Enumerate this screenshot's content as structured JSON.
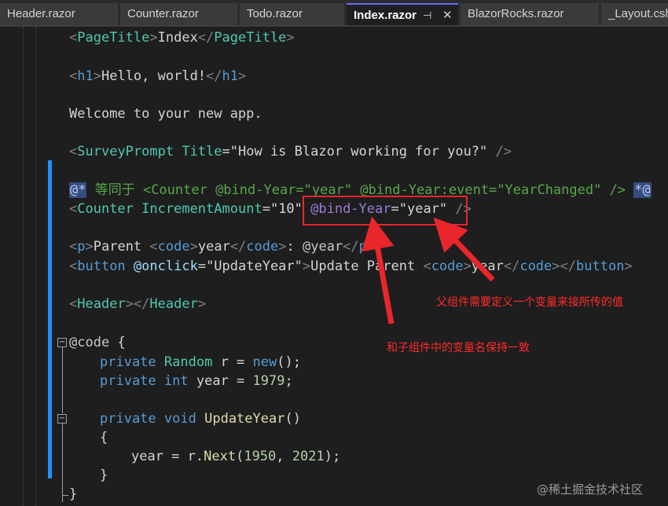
{
  "tabs": [
    {
      "label": "Header.razor"
    },
    {
      "label": "Counter.razor"
    },
    {
      "label": "Todo.razor"
    },
    {
      "label": "Index.razor",
      "pin": "⊣",
      "close": "✕"
    },
    {
      "label": "BlazorRocks.razor"
    },
    {
      "label": "_Layout.csht"
    }
  ],
  "code": {
    "l1": {
      "lt": "<",
      "tag": "PageTitle",
      "gt": ">",
      "text": "Index",
      "lt2": "</",
      "tag2": "PageTitle",
      "gt2": ">"
    },
    "l3": {
      "lt": "<",
      "tag": "h1",
      "gt": ">",
      "text": "Hello, world!",
      "lt2": "</",
      "tag2": "h1",
      "gt2": ">"
    },
    "l5": {
      "text": "Welcome to your new app."
    },
    "l7": {
      "lt": "<",
      "tag": "SurveyPrompt",
      "attr": "Title",
      "eq": "=",
      "str": "\"How is Blazor working for you?\"",
      "end": " />"
    },
    "l9": {
      "start": "@*",
      "comment": " 等同于 <Counter @bind-Year=\"year\" @bind-Year:event=\"YearChanged\" /> ",
      "end": "*@"
    },
    "l10": {
      "lt": "<",
      "tag": "Counter",
      "attr": "IncrementAmount",
      "eq": "=",
      "str": "\"10\"",
      "bind": "@bind-Year",
      "eq2": "=",
      "str2": "\"year\"",
      "end": " />"
    },
    "l12": {
      "lt": "<",
      "tag": "p",
      "gt": ">",
      "text": "Parent ",
      "lt2": "<",
      "tag2": "code",
      "gt2": ">",
      "var": "year",
      "lt3": "</",
      "tag3": "code",
      "gt3": ">",
      "colon": ": ",
      "razor": "@year",
      "lt4": "</",
      "tag4": "p",
      "gt4": ">"
    },
    "l13": {
      "lt": "<",
      "tag": "button",
      "attr": "@onclick",
      "eq": "=",
      "str": "\"UpdateYear\"",
      "gt": ">",
      "text": "Update Parent ",
      "lt2": "<",
      "tag2": "code",
      "gt2": ">",
      "var": "year",
      "lt3": "</",
      "tag3": "code",
      "gt3": ">",
      "lt4": "</",
      "tag4": "button",
      "gt4": ">"
    },
    "l15": {
      "lt": "<",
      "tag": "Header",
      "gt": ">",
      "lt2": "</",
      "tag2": "Header",
      "gt2": ">"
    },
    "l17": {
      "kw": "@code",
      "brace": " {"
    },
    "l18": {
      "kw": "private",
      "type": "Random",
      "name": " r = ",
      "kw2": "new",
      "end": "();"
    },
    "l19": {
      "kw": "private",
      "kw2": "int",
      "name": " year = ",
      "num": "1979",
      "end": ";"
    },
    "l21": {
      "kw": "private",
      "kw2": "void",
      "fn": "UpdateYear",
      "end": "()"
    },
    "l22": {
      "text": "{"
    },
    "l23": {
      "name": "year = r.",
      "fn": "Next",
      "p1": "(",
      "n1": "1950",
      "comma": ", ",
      "n2": "2021",
      "end": ");"
    },
    "l24": {
      "text": "}"
    },
    "l25": {
      "text": "}"
    }
  },
  "fold": {
    "collapse": "−"
  },
  "annotations": {
    "a1": "父组件需要定义一个变量来接所传的值",
    "a2": "和子组件中的变量名保持一致"
  },
  "watermark": "@稀土掘金技术社区",
  "colors": {
    "annotation": "#e8262b",
    "accent": "#1e90ff"
  }
}
